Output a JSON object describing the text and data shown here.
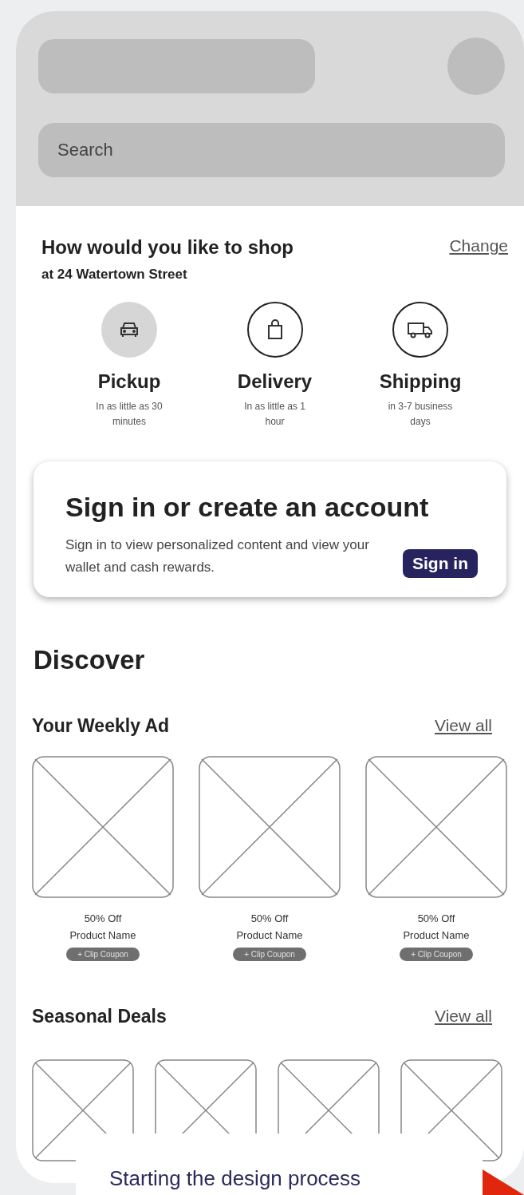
{
  "header": {
    "search": {
      "placeholder": "Search"
    }
  },
  "shop": {
    "title": "How would you like to shop",
    "address": "at 24 Watertown Street",
    "change_link": "Change",
    "modes": [
      {
        "kind": "pickup",
        "label": "Pickup",
        "note": "In as little as 30 minutes",
        "selected": true
      },
      {
        "kind": "delivery",
        "label": "Delivery",
        "note": "In as little as 1 hour",
        "selected": false
      },
      {
        "kind": "shipping",
        "label": "Shipping",
        "note": "in 3-7 business days",
        "selected": false
      }
    ]
  },
  "account_card": {
    "title": "Sign in or create an account",
    "text": "Sign in to view personalized content  and  view your wallet and cash rewards.",
    "button": "Sign in"
  },
  "discover": {
    "title": "Discover",
    "weekly_ad": {
      "title": "Your Weekly Ad",
      "link": "View all",
      "items": [
        {
          "discount": "50% Off",
          "name": "Product Name",
          "button": "+ Clip Coupon"
        },
        {
          "discount": "50% Off",
          "name": "Product Name",
          "button": "+ Clip Coupon"
        },
        {
          "discount": "50% Off",
          "name": "Product Name",
          "button": "+ Clip Coupon"
        }
      ]
    },
    "seasonal_deals": {
      "title": "Seasonal Deals",
      "link": "View all"
    }
  },
  "overlay": {
    "title": "Starting the design process"
  }
}
